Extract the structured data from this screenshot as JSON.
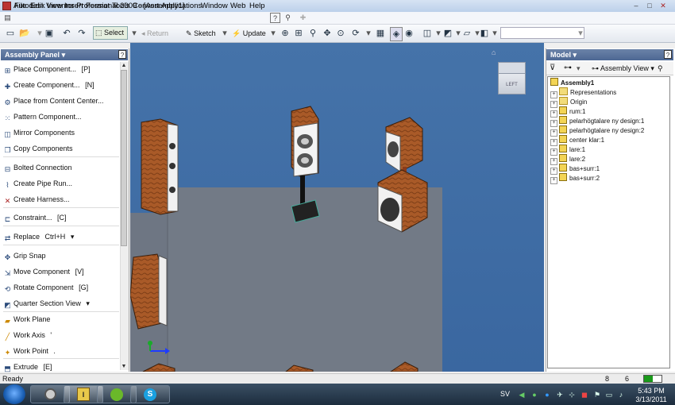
{
  "window": {
    "title": "Autodesk Inventor Professional 2009 - [Assembly1]",
    "controls": [
      "–",
      "□",
      "✕"
    ]
  },
  "menu": [
    "File",
    "Edit",
    "View",
    "Insert",
    "Format",
    "Tools",
    "Convert",
    "Applications",
    "Window",
    "Web",
    "Help"
  ],
  "toolbar": {
    "select": "Select",
    "return": "Return",
    "sketch": "Sketch",
    "update": "Update"
  },
  "assembly_panel": {
    "title": "Assembly Panel",
    "items": [
      {
        "label": "Place Component...",
        "shortcut": "[P]"
      },
      {
        "label": "Create Component...",
        "shortcut": "[N]"
      },
      {
        "label": "Place from Content Center...",
        "shortcut": ""
      },
      {
        "label": "Pattern Component...",
        "shortcut": ""
      },
      {
        "label": "Mirror Components",
        "shortcut": ""
      },
      {
        "label": "Copy Components",
        "shortcut": ""
      },
      {
        "label": "Bolted Connection",
        "shortcut": ""
      },
      {
        "label": "Create Pipe Run...",
        "shortcut": ""
      },
      {
        "label": "Create Harness...",
        "shortcut": ""
      },
      {
        "label": "Constraint...",
        "shortcut": "[C]"
      },
      {
        "label": "Replace",
        "shortcut": "Ctrl+H"
      },
      {
        "label": "Grip Snap",
        "shortcut": ""
      },
      {
        "label": "Move Component",
        "shortcut": "[V]"
      },
      {
        "label": "Rotate Component",
        "shortcut": "[G]"
      },
      {
        "label": "Quarter Section View",
        "shortcut": ""
      },
      {
        "label": "Work Plane",
        "shortcut": ""
      },
      {
        "label": "Work Axis",
        "shortcut": "'"
      },
      {
        "label": "Work Point",
        "shortcut": "."
      },
      {
        "label": "Extrude",
        "shortcut": "[E]"
      }
    ]
  },
  "viewcube": {
    "face": "LEFT"
  },
  "model_panel": {
    "title": "Model",
    "view": "Assembly View",
    "root": "Assembly1",
    "nodes": [
      {
        "label": "Representations",
        "icon": "representations-icon"
      },
      {
        "label": "Origin",
        "icon": "folder-icon"
      },
      {
        "label": "rum:1",
        "icon": "part-icon"
      },
      {
        "label": "pelarhögtalare ny design:1",
        "icon": "part-icon"
      },
      {
        "label": "pelarhögtalare ny design:2",
        "icon": "part-icon"
      },
      {
        "label": "center klar:1",
        "icon": "part-icon"
      },
      {
        "label": "lare:1",
        "icon": "part-icon"
      },
      {
        "label": "lare:2",
        "icon": "part-icon"
      },
      {
        "label": "bas+surr:1",
        "icon": "part-icon"
      },
      {
        "label": "bas+surr:2",
        "icon": "part-icon"
      }
    ]
  },
  "status": {
    "text": "Ready",
    "n1": "8",
    "n2": "6"
  },
  "taskbar": {
    "language": "SV",
    "time": "5:43 PM",
    "date": "3/13/2011"
  },
  "colors": {
    "viewport": "#3f6ca4",
    "wood": "#a95a28",
    "floor": "#6e7683",
    "panel_header": "#5a739c"
  }
}
